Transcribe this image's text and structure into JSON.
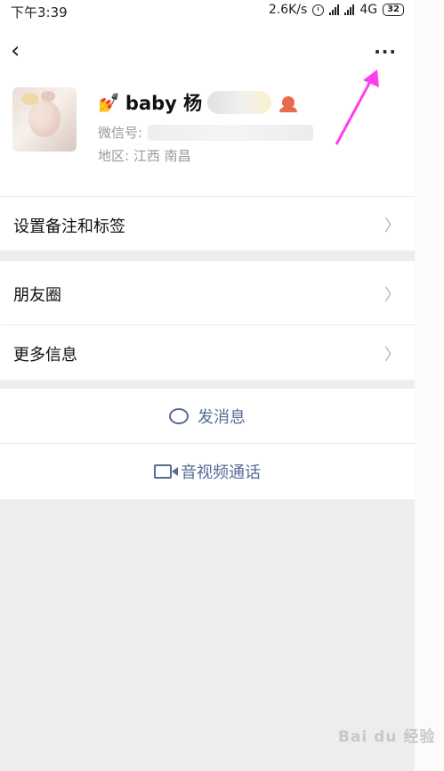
{
  "status_bar": {
    "time": "下午3:39",
    "speed": "2.6K/s",
    "network": "4G",
    "battery": "32"
  },
  "header": {
    "back_icon": "‹",
    "more_icon": "···"
  },
  "profile": {
    "nickname": "baby 杨",
    "wechat_id_label": "微信号:",
    "region_label": "地区:",
    "region_value": "江西  南昌"
  },
  "menu": {
    "remarks_tags": "设置备注和标签",
    "moments": "朋友圈",
    "more_info": "更多信息"
  },
  "actions": {
    "send_message": "发消息",
    "video_call": "音视频通话"
  },
  "watermark": "Bai du 经验",
  "colors": {
    "accent": "#576b95",
    "annotation": "#ff3df0"
  }
}
